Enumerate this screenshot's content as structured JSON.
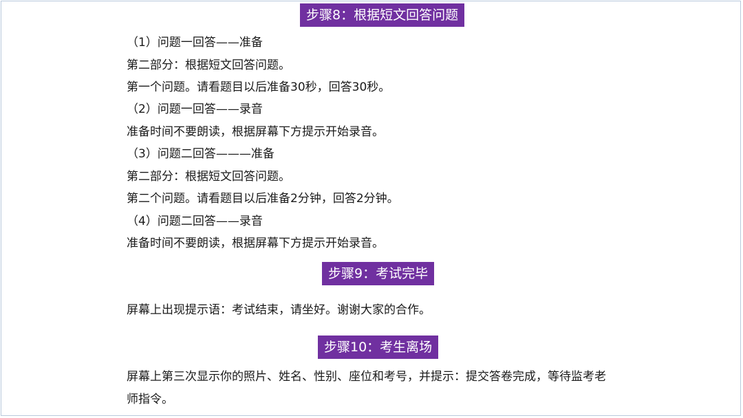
{
  "step8": {
    "title": "步骤8：根据短文回答问题",
    "lines": [
      "（1）问题一回答——准备",
      "第二部分：根据短文回答问题。",
      "第一个问题。请看题目以后准备30秒，回答30秒。",
      "（2）问题一回答——录音",
      "准备时间不要朗读，根据屏幕下方提示开始录音。",
      "（3）问题二回答———准备",
      "第二部分：根据短文回答问题。",
      "第二个问题。请看题目以后准备2分钟，回答2分钟。",
      "（4）问题二回答——录音",
      "准备时间不要朗读，根据屏幕下方提示开始录音。"
    ]
  },
  "step9": {
    "title": "步骤9：考试完毕",
    "lines": [
      "屏幕上出现提示语：考试结束，请坐好。谢谢大家的合作。"
    ]
  },
  "step10": {
    "title": "步骤10：考生离场",
    "lines": [
      "屏幕上第三次显示你的照片、姓名、性别、座位和考号，并提示：提交答卷完成，等待监考老",
      "师指令。"
    ]
  },
  "colors": {
    "banner_bg": "#7030a0",
    "banner_text": "#ffffff",
    "frame_border": "#b8c8dc"
  }
}
